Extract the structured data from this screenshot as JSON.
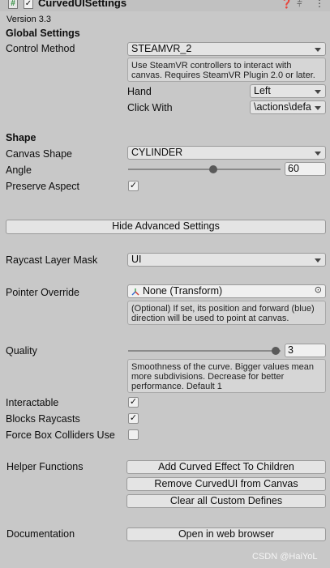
{
  "header": {
    "title": "CurvedUISettings",
    "enabled_check": "✓",
    "component_icon": "#",
    "icons": [
      "help-icon",
      "presets-icon",
      "more-icon"
    ]
  },
  "version": "Version 3.3",
  "global": {
    "title": "Global Settings",
    "control_method_label": "Control Method",
    "control_method_value": "STEAMVR_2",
    "help": "Use SteamVR controllers to interact with canvas. Requires SteamVR Plugin 2.0 or later.",
    "hand_label": "Hand",
    "hand_value": "Left",
    "click_with_label": "Click With",
    "click_with_value": "\\actions\\defa"
  },
  "shape": {
    "title": "Shape",
    "canvas_shape_label": "Canvas Shape",
    "canvas_shape_value": "CYLINDER",
    "angle_label": "Angle",
    "angle_value": "60",
    "angle_fraction": 0.56,
    "preserve_aspect_label": "Preserve Aspect",
    "preserve_aspect_checked": "✓"
  },
  "advanced": {
    "toggle_button": "Hide Advanced Settings",
    "raycast_label": "Raycast Layer Mask",
    "raycast_value": "UI",
    "pointer_override_label": "Pointer Override",
    "pointer_override_value": "None (Transform)",
    "pointer_help": "(Optional) If set, its position and forward (blue) direction will be used to point at canvas.",
    "quality_label": "Quality",
    "quality_value": "3",
    "quality_fraction": 0.97,
    "quality_help": "Smoothness of the curve. Bigger values mean more subdivisions. Decrease for better performance. Default 1",
    "interactable_label": "Interactable",
    "interactable_checked": "✓",
    "blocks_raycasts_label": "Blocks Raycasts",
    "blocks_raycasts_checked": "✓",
    "force_box_label": "Force Box Colliders Use",
    "force_box_checked": ""
  },
  "helpers": {
    "label": "Helper Functions",
    "add_button": "Add Curved Effect To Children",
    "remove_button": "Remove CurvedUI from Canvas",
    "clear_button": "Clear all Custom Defines"
  },
  "documentation": {
    "label": "Documentation",
    "open_button": "Open in web browser"
  },
  "watermark": "CSDN @HaiYoL"
}
